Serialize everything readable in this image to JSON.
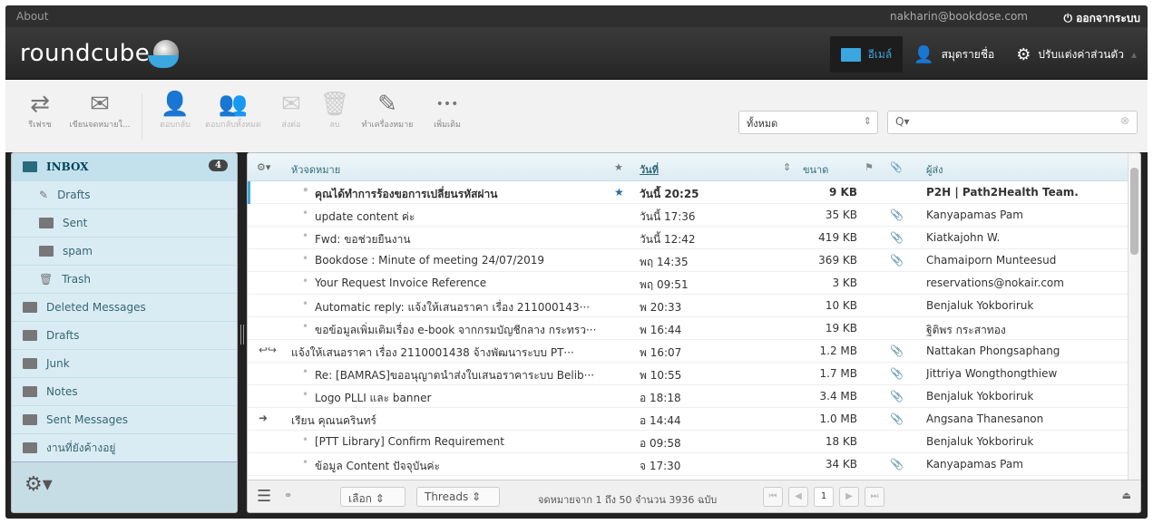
{
  "topline": {
    "about": "About",
    "user": "nakharin@bookdose.com",
    "logout": "ออกจากระบบ"
  },
  "app": {
    "logo": "roundcube"
  },
  "tasks": [
    {
      "label": "อีเมล์"
    },
    {
      "label": "สมุดรายชื่อ"
    },
    {
      "label": "ปรับแต่งค่าส่วนตัว"
    }
  ],
  "toolbar": {
    "items": [
      {
        "label": "รีเฟรช"
      },
      {
        "label": "เขียนจดหมายใ..."
      },
      {
        "label": "ตอบกลับ"
      },
      {
        "label": "ตอบกลับทั้งหมด"
      },
      {
        "label": "ส่งต่อ"
      },
      {
        "label": "ลบ"
      },
      {
        "label": "ทำเครื่องหมาย"
      },
      {
        "label": "เพิ่มเติม"
      }
    ]
  },
  "filter": {
    "value": "ทั้งหมด"
  },
  "search": {
    "placeholder": "Q▾"
  },
  "folders": [
    {
      "name": "INBOX",
      "count": "4"
    },
    {
      "name": "Drafts"
    },
    {
      "name": "Sent"
    },
    {
      "name": "spam"
    },
    {
      "name": "Trash"
    },
    {
      "name": "Deleted Messages"
    },
    {
      "name": "Drafts"
    },
    {
      "name": "Junk"
    },
    {
      "name": "Notes"
    },
    {
      "name": "Sent Messages"
    },
    {
      "name": "งานที่ยังค้างอยู่"
    }
  ],
  "list": {
    "columns": {
      "subject": "หัวจดหมาย",
      "date": "วันที่",
      "size": "ขนาด",
      "from": "ผู้ส่ง"
    },
    "rows": [
      {
        "subject": "คุณได้ทำการร้องขอการเปลี่ยนรหัสผ่าน",
        "date": "วันนี้ 20:25",
        "size": "9 KB",
        "from": "P2H | Path2Health Team.",
        "unread": true,
        "flag": "★",
        "att": ""
      },
      {
        "subject": "update content ค่ะ",
        "date": "วันนี้ 17:36",
        "size": "35 KB",
        "from": "Kanyapamas Pam",
        "att": "📎"
      },
      {
        "subject": "Fwd: ขอช่วยยืนงาน",
        "date": "วันนี้ 12:42",
        "size": "419 KB",
        "from": "Kiatkajohn W.",
        "att": "📎"
      },
      {
        "subject": "Bookdose : Minute of meeting 24/07/2019",
        "date": "พฤ 14:35",
        "size": "369 KB",
        "from": "Chamaiporn Munteesud",
        "att": "📎"
      },
      {
        "subject": "Your Request Invoice Reference",
        "date": "พฤ 09:51",
        "size": "3 KB",
        "from": "reservations@nokair.com",
        "att": ""
      },
      {
        "subject": "Automatic reply: แจ้งให้เสนอราคา เรื่อง 211000143···",
        "date": "พ 20:33",
        "size": "10 KB",
        "from": "Benjaluk Yokboriruk",
        "att": ""
      },
      {
        "subject": "ขอข้อมูลเพิ่มเติมเรื่อง e-book จากกรมบัญชีกลาง กระทรว···",
        "date": "พ 16:44",
        "size": "19 KB",
        "from": "ฐิติพร กระสาทอง",
        "att": ""
      },
      {
        "subject": "แจ้งให้เสนอราคา เรื่อง 2110001438 จ้างพัฒนาระบบ PT···",
        "date": "พ 16:07",
        "size": "1.2 MB",
        "from": "Nattakan Phongsaphang",
        "att": "📎",
        "thread": "↩↪"
      },
      {
        "subject": "Re: [BAMRAS]ขออนุญาตนำส่งใบเสนอราคาระบบ Belib···",
        "date": "พ 10:55",
        "size": "1.7 MB",
        "from": "Jittriya Wongthongthiew",
        "att": "📎"
      },
      {
        "subject": "Logo PLLI และ banner",
        "date": "อ 18:18",
        "size": "3.4 MB",
        "from": "Benjaluk Yokboriruk",
        "att": "📎"
      },
      {
        "subject": "เรียน คุณนครินทร์",
        "date": "อ 14:44",
        "size": "1.0 MB",
        "from": "Angsana Thanesanon",
        "att": "📎",
        "thread": "➜"
      },
      {
        "subject": "[PTT Library] Confirm Requirement",
        "date": "อ 09:58",
        "size": "18 KB",
        "from": "Benjaluk Yokboriruk",
        "att": ""
      },
      {
        "subject": "ข้อมูล Content ปัจจุบันค่ะ",
        "date": "จ 17:30",
        "size": "34 KB",
        "from": "Kanyapamas Pam",
        "att": "📎"
      }
    ]
  },
  "footer": {
    "select": "เลือก",
    "threads": "Threads",
    "count": "จดหมายจาก 1 ถึง 50 จำนวน 3936 ฉบับ",
    "page": "1"
  }
}
